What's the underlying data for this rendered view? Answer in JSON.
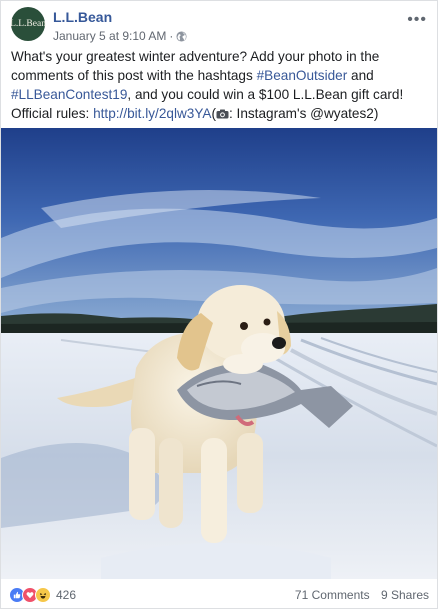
{
  "page": {
    "name": "L.L.Bean",
    "logo_text": "L.L.Bean",
    "date": "January 5 at 9:10 AM",
    "separator": "·",
    "privacy_icon": "globe-icon",
    "more_icon": "more-options-icon"
  },
  "post": {
    "text_1": "What's your greatest winter adventure? Add your photo in the comments of this post with the hashtags ",
    "hashtag_1": "#BeanOutsider",
    "text_2": " and ",
    "hashtag_2": "#LLBeanContest19",
    "text_3": ", and you could win a $100 L.L.Bean gift card! Official rules: ",
    "link": "http://bit.ly/2qlw3YA",
    "text_4": "(",
    "camera_icon": "camera-icon",
    "text_5": ": Instagram's @wyates2)"
  },
  "photo": {
    "subject": "golden retriever puppy holding a toy fish on a frozen snowy lake"
  },
  "footer": {
    "reaction_icons": [
      "like-icon",
      "love-icon",
      "haha-icon"
    ],
    "reaction_count": "426",
    "comments": "71 Comments",
    "shares": "9 Shares"
  },
  "colors": {
    "link": "#385898",
    "name": "#365899",
    "meta": "#616770",
    "like": "#4a7cf5",
    "love": "#f0516a",
    "haha": "#f6c749"
  }
}
